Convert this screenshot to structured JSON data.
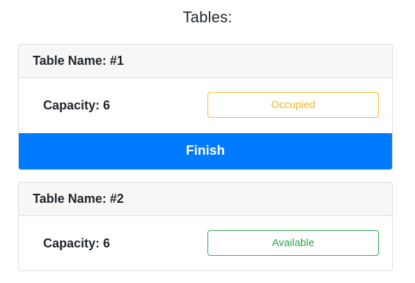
{
  "page": {
    "title": "Tables:"
  },
  "colors": {
    "primary": "#007bff",
    "occupied": "#f0b429",
    "available": "#28a745",
    "card_header_bg": "#f7f7f7",
    "border": "#dcdcdc"
  },
  "tables": [
    {
      "name": "Table Name: #1",
      "capacity": "Capacity: 6",
      "status": "Occupied",
      "action": "Finish"
    },
    {
      "name": "Table Name: #2",
      "capacity": "Capacity: 6",
      "status": "Available"
    }
  ]
}
